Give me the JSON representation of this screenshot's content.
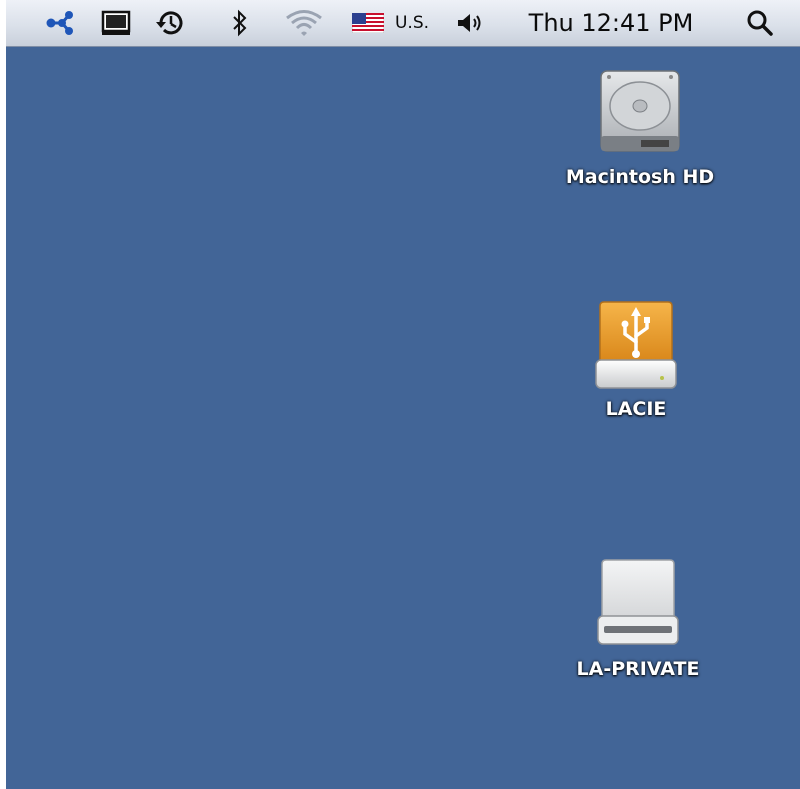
{
  "menubar": {
    "input_source_label": "U.S.",
    "clock": "Thu 12:41 PM",
    "icons": [
      "network-share-icon",
      "display-mirroring-icon",
      "time-machine-icon",
      "bluetooth-icon",
      "wifi-icon",
      "us-flag-icon",
      "volume-icon",
      "spotlight-search-icon"
    ]
  },
  "desktop": {
    "background_color": "#426597",
    "drives": [
      {
        "label": "Macintosh HD",
        "icon": "hard-drive-icon"
      },
      {
        "label": "LACIE",
        "icon": "usb-drive-icon"
      },
      {
        "label": "LA-PRIVATE",
        "icon": "external-drive-icon"
      }
    ]
  }
}
